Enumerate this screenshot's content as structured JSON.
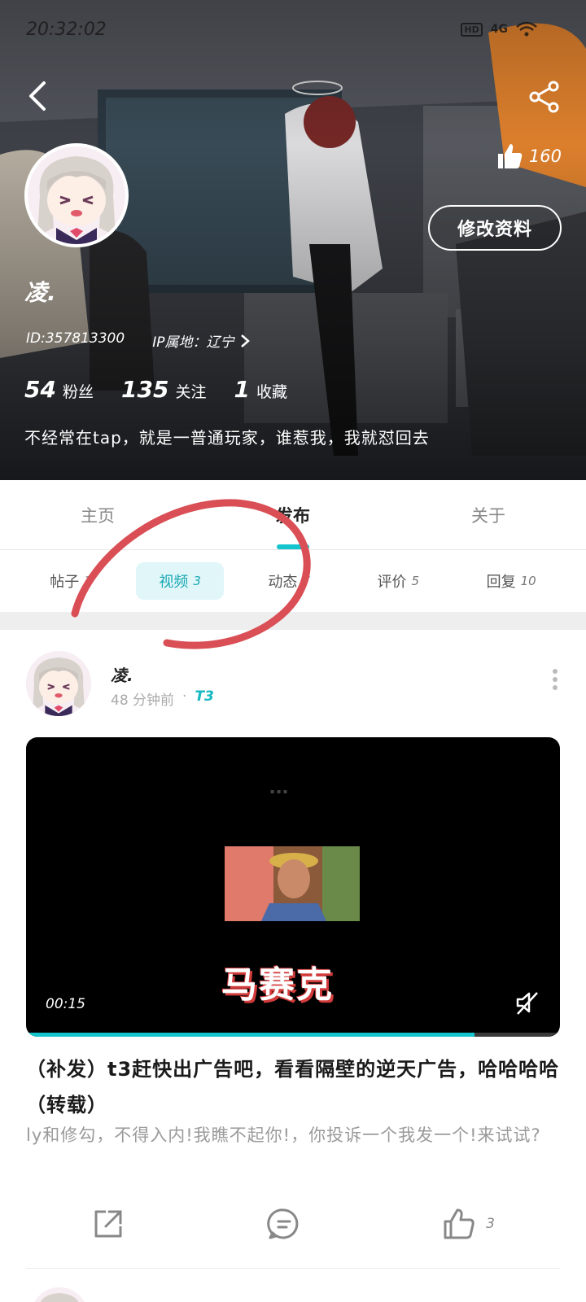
{
  "status_bar": {
    "time": "20:32:02",
    "network": "4G",
    "hd_badge": "HD",
    "wifi_icon": "wifi-icon"
  },
  "profile": {
    "like_count": "160",
    "edit_button": "修改资料",
    "username": "凌.",
    "id_text": "ID:357813300",
    "ip_text": "IP属地：辽宁",
    "stats": [
      {
        "num": "54",
        "label": "粉丝"
      },
      {
        "num": "135",
        "label": "关注"
      },
      {
        "num": "1",
        "label": "收藏"
      }
    ],
    "bio": "不经常在tap，就是一普通玩家，谁惹我，我就怼回去"
  },
  "main_tabs": [
    {
      "label": "主页",
      "active": false
    },
    {
      "label": "发布",
      "active": true
    },
    {
      "label": "关于",
      "active": false
    }
  ],
  "sub_tabs": [
    {
      "label": "帖子",
      "count": "1",
      "active": false
    },
    {
      "label": "视频",
      "count": "3",
      "active": true
    },
    {
      "label": "动态",
      "count": "7",
      "active": false
    },
    {
      "label": "评价",
      "count": "5",
      "active": false
    },
    {
      "label": "回复",
      "count": "10",
      "active": false
    }
  ],
  "post": {
    "author": "凌.",
    "time_ago": "48 分钟前",
    "meta_sep": "·",
    "tag": "T3",
    "video": {
      "duration": "00:15",
      "caption": "马赛克",
      "progress": 0.84
    },
    "title": "（补发）t3赶快出广告吧，看看隔壁的逆天广告，哈哈哈哈（转载）",
    "excerpt": "ly和修勾，不得入内!我瞧不起你!，你投诉一个我发一个!来试试?",
    "like_count": "3"
  },
  "colors": {
    "accent": "#15c5ce",
    "annotation": "#d94f55"
  }
}
